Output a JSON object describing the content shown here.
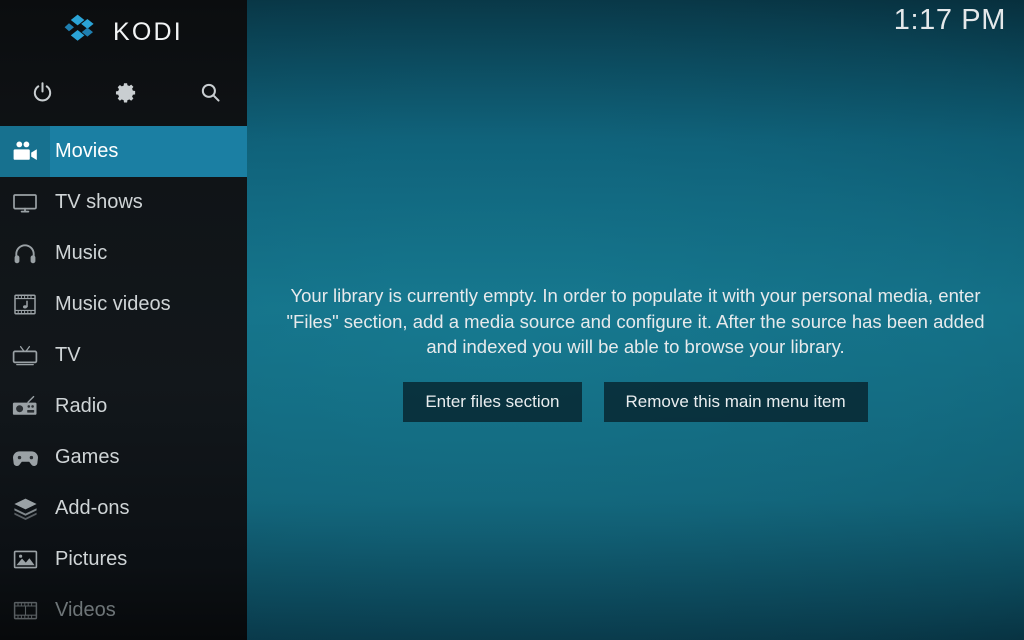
{
  "app": {
    "brand_name": "KODI",
    "logo_icon": "kodi-logo-icon",
    "accent_color": "#1b7fa3",
    "sidebar_bg": "#10151a",
    "background_color": "#0a4757"
  },
  "clock": {
    "time": "1:17 PM"
  },
  "toolbar": {
    "buttons": [
      {
        "name": "power-icon",
        "label": "Power"
      },
      {
        "name": "gear-icon",
        "label": "Settings"
      },
      {
        "name": "search-icon",
        "label": "Search"
      }
    ]
  },
  "sidebar": {
    "items": [
      {
        "label": "Movies",
        "icon": "movie-camera-icon",
        "selected": true,
        "dim": false
      },
      {
        "label": "TV shows",
        "icon": "monitor-icon",
        "selected": false,
        "dim": false
      },
      {
        "label": "Music",
        "icon": "headphones-icon",
        "selected": false,
        "dim": false
      },
      {
        "label": "Music videos",
        "icon": "music-film-icon",
        "selected": false,
        "dim": false
      },
      {
        "label": "TV",
        "icon": "tv-icon",
        "selected": false,
        "dim": false
      },
      {
        "label": "Radio",
        "icon": "radio-icon",
        "selected": false,
        "dim": false
      },
      {
        "label": "Games",
        "icon": "gamepad-icon",
        "selected": false,
        "dim": false
      },
      {
        "label": "Add-ons",
        "icon": "package-icon",
        "selected": false,
        "dim": false
      },
      {
        "label": "Pictures",
        "icon": "picture-icon",
        "selected": false,
        "dim": false
      },
      {
        "label": "Videos",
        "icon": "film-strip-icon",
        "selected": false,
        "dim": true
      }
    ]
  },
  "main": {
    "empty_message": "Your library is currently empty. In order to populate it with your personal media, enter \"Files\" section, add a media source and configure it. After the source has been added and indexed you will be able to browse your library.",
    "buttons": [
      {
        "label": "Enter files section"
      },
      {
        "label": "Remove this main menu item"
      }
    ]
  }
}
